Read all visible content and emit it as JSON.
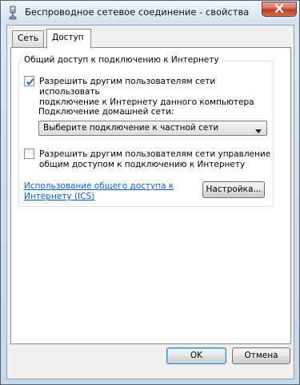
{
  "window": {
    "title": "Беспроводное сетевое соединение - свойства",
    "icon": "network-adapter-icon",
    "close_icon": "close-icon"
  },
  "tabs": [
    {
      "label": "Сеть",
      "selected": false
    },
    {
      "label": "Доступ",
      "selected": true
    }
  ],
  "sharing": {
    "group_title": "Общий доступ к подключению к Интернету",
    "allow_others_connect": {
      "label": "Разрешить другим пользователям сети использовать\nподключение к Интернету данного компьютера",
      "checked": true
    },
    "home_network_label": "Подключение домашней сети:",
    "home_network_select": {
      "value": "Выберите подключение к частной сети"
    },
    "allow_others_control": {
      "label": "Разрешить другим пользователям сети управление\nобщим доступом к подключению к Интернету",
      "checked": false
    },
    "ics_link": "Использование общего доступа к\nИнтернету (ICS)",
    "settings_button": "Настройка..."
  },
  "footer": {
    "ok_button": "OK",
    "cancel_button": "Отмена"
  }
}
